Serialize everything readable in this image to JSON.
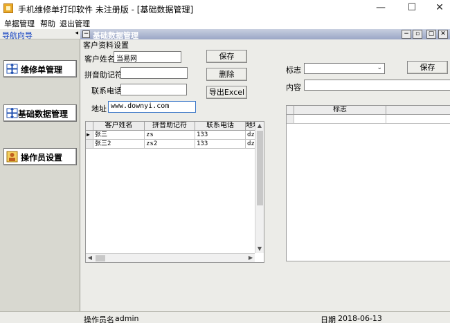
{
  "window": {
    "title": "手机维修单打印软件 未注册版   - [基础数据管理]",
    "min_glyph": "—",
    "max_glyph": "☐",
    "close_glyph": "✕"
  },
  "menu": [
    "单据管理",
    "帮助",
    "退出管理"
  ],
  "sidebar": {
    "header": "导航向导",
    "collapse_glyph": "◂",
    "items": [
      {
        "label": "维修单管理",
        "icon": "arrows-icon"
      },
      {
        "label": "基础数据管理",
        "icon": "arrows-icon"
      },
      {
        "label": "操作员设置",
        "icon": "user-icon"
      }
    ]
  },
  "child_window": {
    "title": "基础数据管理",
    "system_glyph": "−",
    "controls": [
      "−",
      "▫",
      "▢",
      "✕"
    ]
  },
  "customer": {
    "group_label": "客户资料设置",
    "name_label": "客户姓名",
    "name_value": "当易网",
    "pinyin_label": "拼音助记符",
    "pinyin_value": "",
    "phone_label": "联系电话",
    "phone_value": "",
    "address_label": "地址",
    "address_value": "www.downyi.com",
    "buttons": {
      "save": "保存",
      "delete": "删除",
      "export": "导出Excel"
    }
  },
  "customer_table": {
    "columns": [
      "客户姓名",
      "拼音助记符",
      "联系电话",
      "地址"
    ],
    "rows": [
      [
        "张三",
        "zs",
        "133",
        "dz"
      ],
      [
        "张三2",
        "zs2",
        "133",
        "dz"
      ]
    ],
    "current_row_marker": "▶"
  },
  "tag_panel": {
    "tag_label": "标志",
    "tag_value": "",
    "content_label": "内容",
    "content_value": "",
    "save_button": "保存",
    "table_columns": [
      "标志"
    ]
  },
  "status": {
    "operator_label": "操作员名",
    "operator_value": "admin",
    "date_label": "日期",
    "date_value": "2018-06-13"
  }
}
